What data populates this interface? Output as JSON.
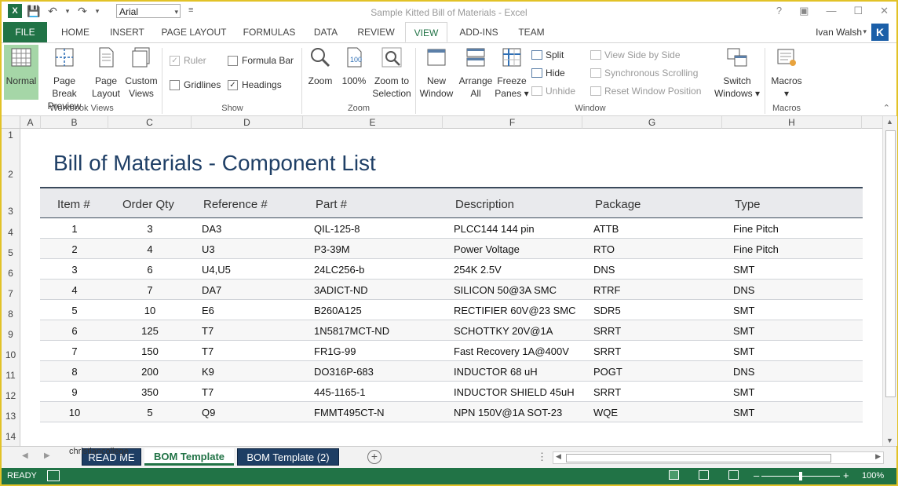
{
  "window": {
    "title": "Sample Kitted Bill of Materials - Excel",
    "font_name": "Arial"
  },
  "ribbon_tabs": [
    {
      "label": "FILE"
    },
    {
      "label": "HOME"
    },
    {
      "label": "INSERT"
    },
    {
      "label": "PAGE LAYOUT"
    },
    {
      "label": "FORMULAS"
    },
    {
      "label": "DATA"
    },
    {
      "label": "REVIEW"
    },
    {
      "label": "VIEW"
    },
    {
      "label": "ADD-INS"
    },
    {
      "label": "TEAM"
    }
  ],
  "active_tab": "VIEW",
  "user": {
    "name": "Ivan Walsh",
    "initial": "K"
  },
  "ribbon": {
    "workbook_views": {
      "label": "Workbook Views",
      "normal": "Normal",
      "page_break_1": "Page Break",
      "page_break_2": "Preview",
      "page_layout_1": "Page",
      "page_layout_2": "Layout",
      "custom_1": "Custom",
      "custom_2": "Views"
    },
    "show": {
      "label": "Show",
      "ruler": "Ruler",
      "formula_bar": "Formula Bar",
      "gridlines": "Gridlines",
      "headings": "Headings"
    },
    "zoom": {
      "label": "Zoom",
      "zoom": "Zoom",
      "hundred": "100%",
      "sel_1": "Zoom to",
      "sel_2": "Selection"
    },
    "window": {
      "label": "Window",
      "new_1": "New",
      "new_2": "Window",
      "arrange_1": "Arrange",
      "arrange_2": "All",
      "freeze_1": "Freeze",
      "freeze_2": "Panes ▾",
      "split": "Split",
      "hide": "Hide",
      "unhide": "Unhide",
      "side_by_side": "View Side by Side",
      "sync_scroll": "Synchronous Scrolling",
      "reset_pos": "Reset Window Position",
      "switch_1": "Switch",
      "switch_2": "Windows ▾"
    },
    "macros": {
      "label": "Macros",
      "macros": "Macros",
      "dd": "▾"
    }
  },
  "columns": [
    "A",
    "B",
    "C",
    "D",
    "E",
    "F",
    "G",
    "H"
  ],
  "rows": [
    "1",
    "2",
    "3",
    "4",
    "5",
    "6",
    "7",
    "8",
    "9",
    "10",
    "11",
    "12",
    "13",
    "14"
  ],
  "sheet": {
    "title": "Bill of Materials - Component List",
    "headers": [
      "Item #",
      "Order Qty",
      "Reference #",
      "Part #",
      "Description",
      "Package",
      "Type"
    ],
    "rows": [
      [
        "1",
        "3",
        "DA3",
        "QIL-125-8",
        "PLCC144 144 pin",
        "ATTB",
        "Fine Pitch"
      ],
      [
        "2",
        "4",
        "U3",
        "P3-39M",
        "Power Voltage",
        "RTO",
        "Fine Pitch"
      ],
      [
        "3",
        "6",
        "U4,U5",
        "24LC256-b",
        "254K 2.5V",
        "DNS",
        "SMT"
      ],
      [
        "4",
        "7",
        "DA7",
        "3ADICT-ND",
        "SILICON 50@3A SMC",
        "RTRF",
        "DNS"
      ],
      [
        "5",
        "10",
        "E6",
        "B260A125",
        "RECTIFIER 60V@23 SMC",
        "SDR5",
        "SMT"
      ],
      [
        "6",
        "125",
        "T7",
        "1N5817MCT-ND",
        "SCHOTTKY 20V@1A",
        "SRRT",
        "SMT"
      ],
      [
        "7",
        "150",
        "T7",
        "FR1G-99",
        "Fast Recovery 1A@400V",
        "SRRT",
        "SMT"
      ],
      [
        "8",
        "200",
        "K9",
        "DO316P-683",
        "INDUCTOR 68 uH",
        "POGT",
        "DNS"
      ],
      [
        "9",
        "350",
        "T7",
        "445-1165-1",
        "INDUCTOR SHIELD 45uH",
        "SRRT",
        "SMT"
      ],
      [
        "10",
        "5",
        "Q9",
        "FMMT495CT-N",
        "NPN 150V@1A SOT-23",
        "WQE",
        "SMT"
      ]
    ]
  },
  "sheet_tabs": {
    "overlay": "christiancollege",
    "read_me": "READ ME",
    "bom": "BOM Template",
    "bom2": "BOM Template (2)"
  },
  "status": {
    "ready": "READY",
    "zoom": "100%"
  },
  "colors": {
    "excel_green": "#217346",
    "title_blue": "#1f3f66",
    "tab_dark": "#1e3e64",
    "frame": "#e2c227"
  }
}
